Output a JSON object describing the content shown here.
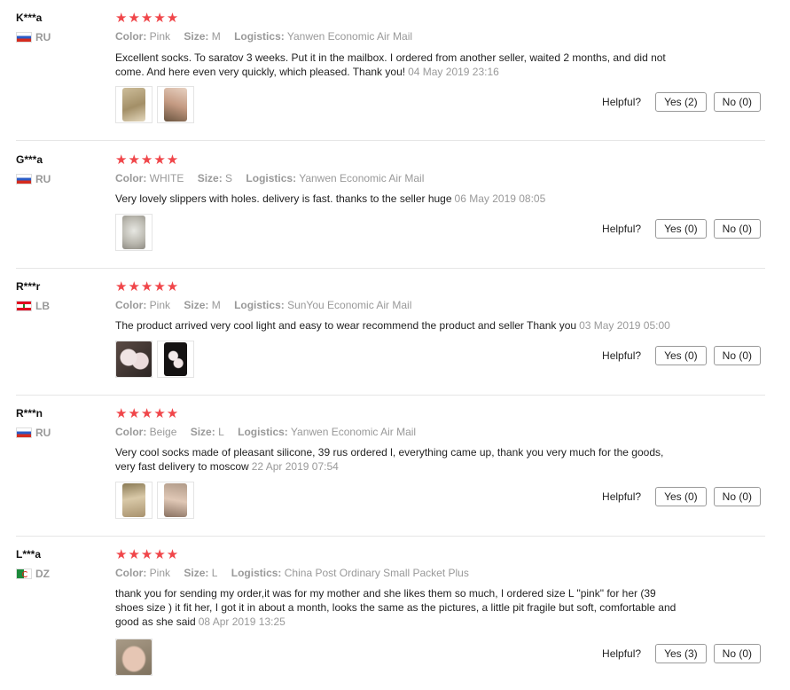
{
  "helpful_label": "Helpful?",
  "colors": {
    "star": "#f0464a",
    "muted": "#999999",
    "text": "#222222"
  },
  "reviews": [
    {
      "user": "K***a",
      "country": "RU",
      "flag": "ru",
      "stars": "★★★★★",
      "color_label": "Color:",
      "color": "Pink",
      "size_label": "Size:",
      "size": "M",
      "logistics_label": "Logistics:",
      "logistics": "Yanwen Economic Air Mail",
      "text": "Excellent socks. To saratov 3 weeks. Put it in the mailbox. I ordered from another seller, waited 2 months, and did not come. And here even very quickly, which pleased. Thank you!",
      "date": "04 May 2019 23:16",
      "yes": "Yes (2)",
      "no": "No (0)"
    },
    {
      "user": "G***a",
      "country": "RU",
      "flag": "ru",
      "stars": "★★★★★",
      "color_label": "Color:",
      "color": "WHITE",
      "size_label": "Size:",
      "size": "S",
      "logistics_label": "Logistics:",
      "logistics": "Yanwen Economic Air Mail",
      "text": "Very lovely slippers with holes. delivery is fast. thanks to the seller huge",
      "date": "06 May 2019 08:05",
      "yes": "Yes (0)",
      "no": "No (0)"
    },
    {
      "user": "R***r",
      "country": "LB",
      "flag": "lb",
      "stars": "★★★★★",
      "color_label": "Color:",
      "color": "Pink",
      "size_label": "Size:",
      "size": "M",
      "logistics_label": "Logistics:",
      "logistics": "SunYou Economic Air Mail",
      "text": "The product arrived very cool light and easy to wear recommend the product and seller Thank you",
      "date": "03 May 2019 05:00",
      "yes": "Yes (0)",
      "no": "No (0)"
    },
    {
      "user": "R***n",
      "country": "RU",
      "flag": "ru",
      "stars": "★★★★★",
      "color_label": "Color:",
      "color": "Beige",
      "size_label": "Size:",
      "size": "L",
      "logistics_label": "Logistics:",
      "logistics": "Yanwen Economic Air Mail",
      "text": "Very cool socks made of pleasant silicone, 39 rus ordered l, everything came up, thank you very much for the goods, very fast delivery to moscow",
      "date": "22 Apr 2019 07:54",
      "yes": "Yes (0)",
      "no": "No (0)"
    },
    {
      "user": "L***a",
      "country": "DZ",
      "flag": "dz",
      "stars": "★★★★★",
      "color_label": "Color:",
      "color": "Pink",
      "size_label": "Size:",
      "size": "L",
      "logistics_label": "Logistics:",
      "logistics": "China Post Ordinary Small Packet Plus",
      "text": "thank you for sending my order,it was for my mother and she likes them so much, I ordered size L \"pink\" for her (39 shoes size ) it fit her, I got it in about a month, looks the same as the pictures, a little pit fragile but soft, comfortable and good as she said",
      "date": "08 Apr 2019 13:25",
      "yes": "Yes (3)",
      "no": "No (0)"
    }
  ]
}
